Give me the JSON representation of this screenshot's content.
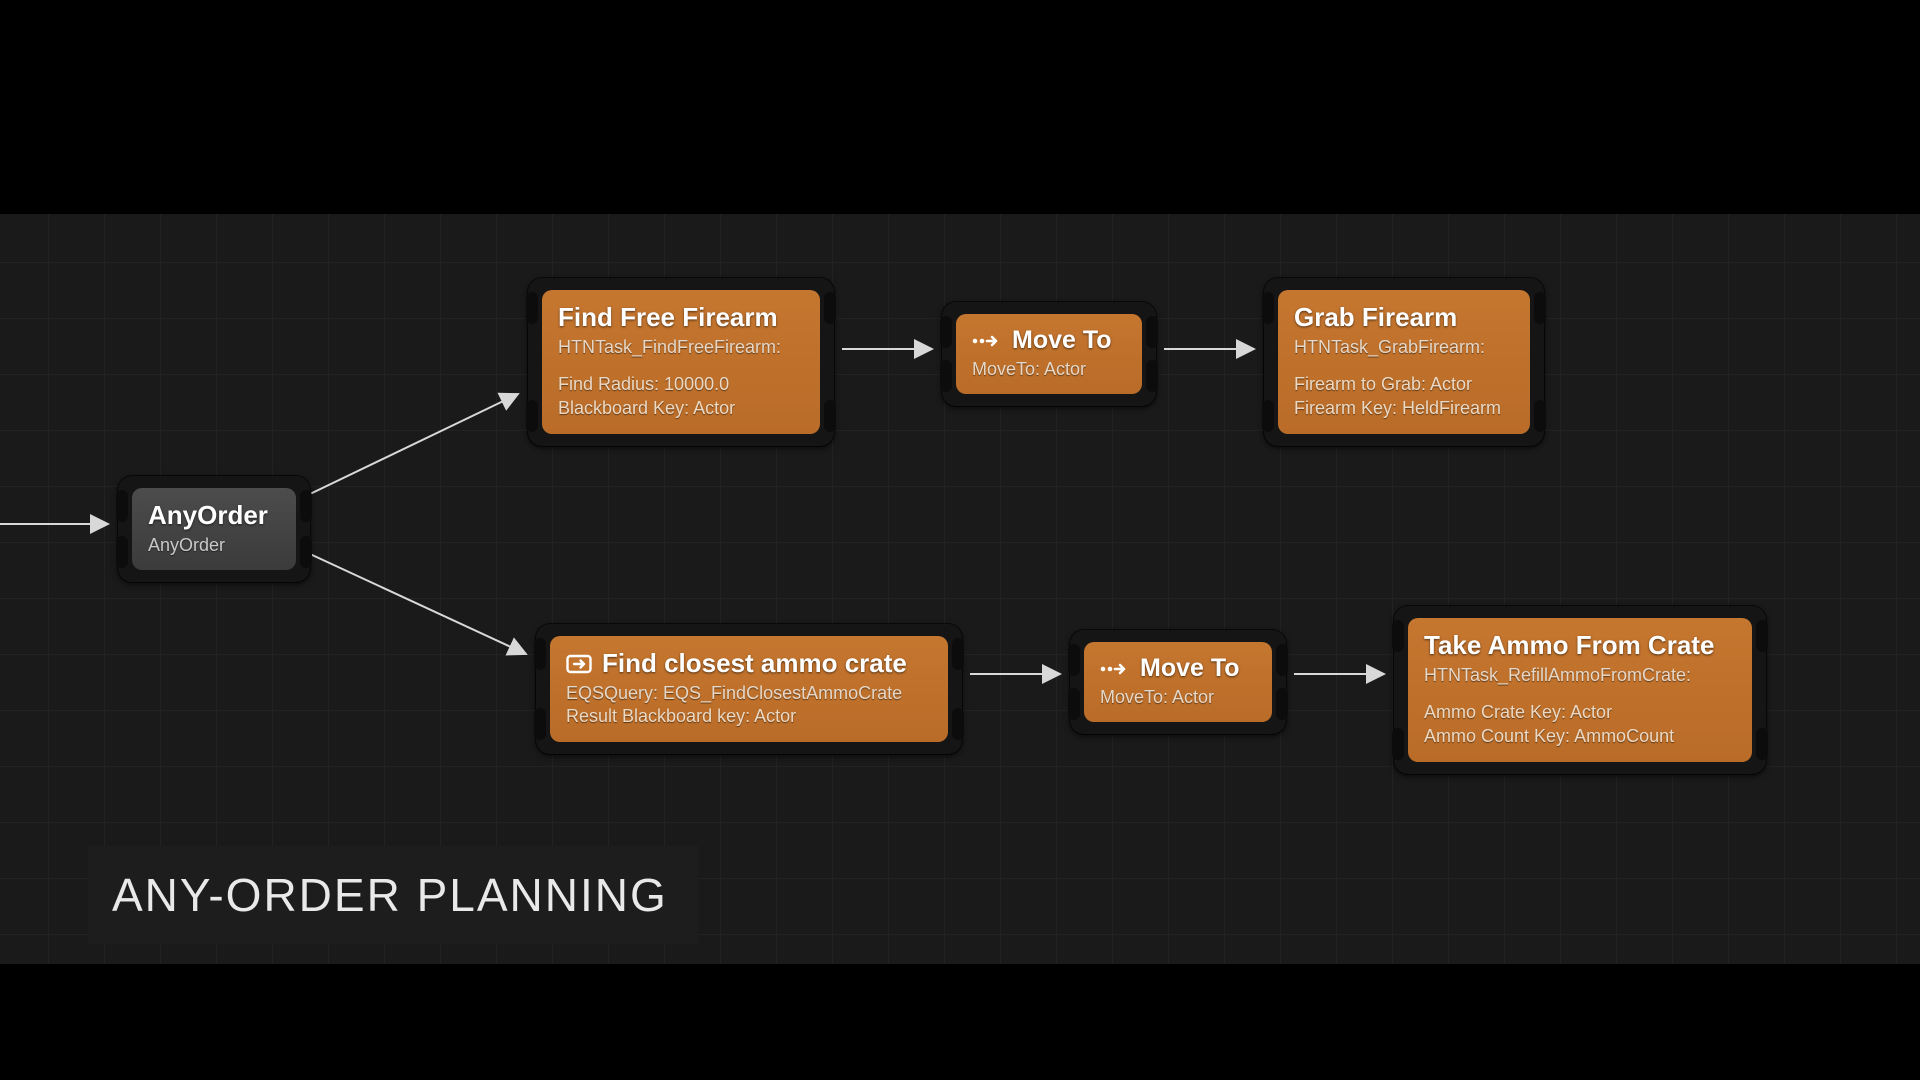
{
  "caption": "ANY-ORDER PLANNING",
  "colors": {
    "orange": "#bf6f2a",
    "gray": "#444",
    "edge": "#d8d8d8"
  },
  "nodes": {
    "anyorder": {
      "title": "AnyOrder",
      "subtitle": "AnyOrder"
    },
    "find_firearm": {
      "title": "Find Free Firearm",
      "subtitle": "HTNTask_FindFreeFirearm:",
      "lines": [
        "Find Radius: 10000.0",
        "Blackboard Key: Actor"
      ]
    },
    "move_to_1": {
      "title": "Move To",
      "subtitle": "MoveTo: Actor"
    },
    "grab_firearm": {
      "title": "Grab Firearm",
      "subtitle": "HTNTask_GrabFirearm:",
      "lines": [
        "Firearm to Grab: Actor",
        "Firearm Key: HeldFirearm"
      ]
    },
    "find_ammo": {
      "title": "Find closest ammo crate",
      "subtitle": "EQSQuery: EQS_FindClosestAmmoCrate",
      "lines": [
        "Result Blackboard key: Actor"
      ]
    },
    "move_to_2": {
      "title": "Move To",
      "subtitle": "MoveTo: Actor"
    },
    "take_ammo": {
      "title": "Take Ammo From Crate",
      "subtitle": "HTNTask_RefillAmmoFromCrate:",
      "lines": [
        "Ammo Crate Key: Actor",
        "Ammo Count Key: AmmoCount"
      ]
    }
  }
}
